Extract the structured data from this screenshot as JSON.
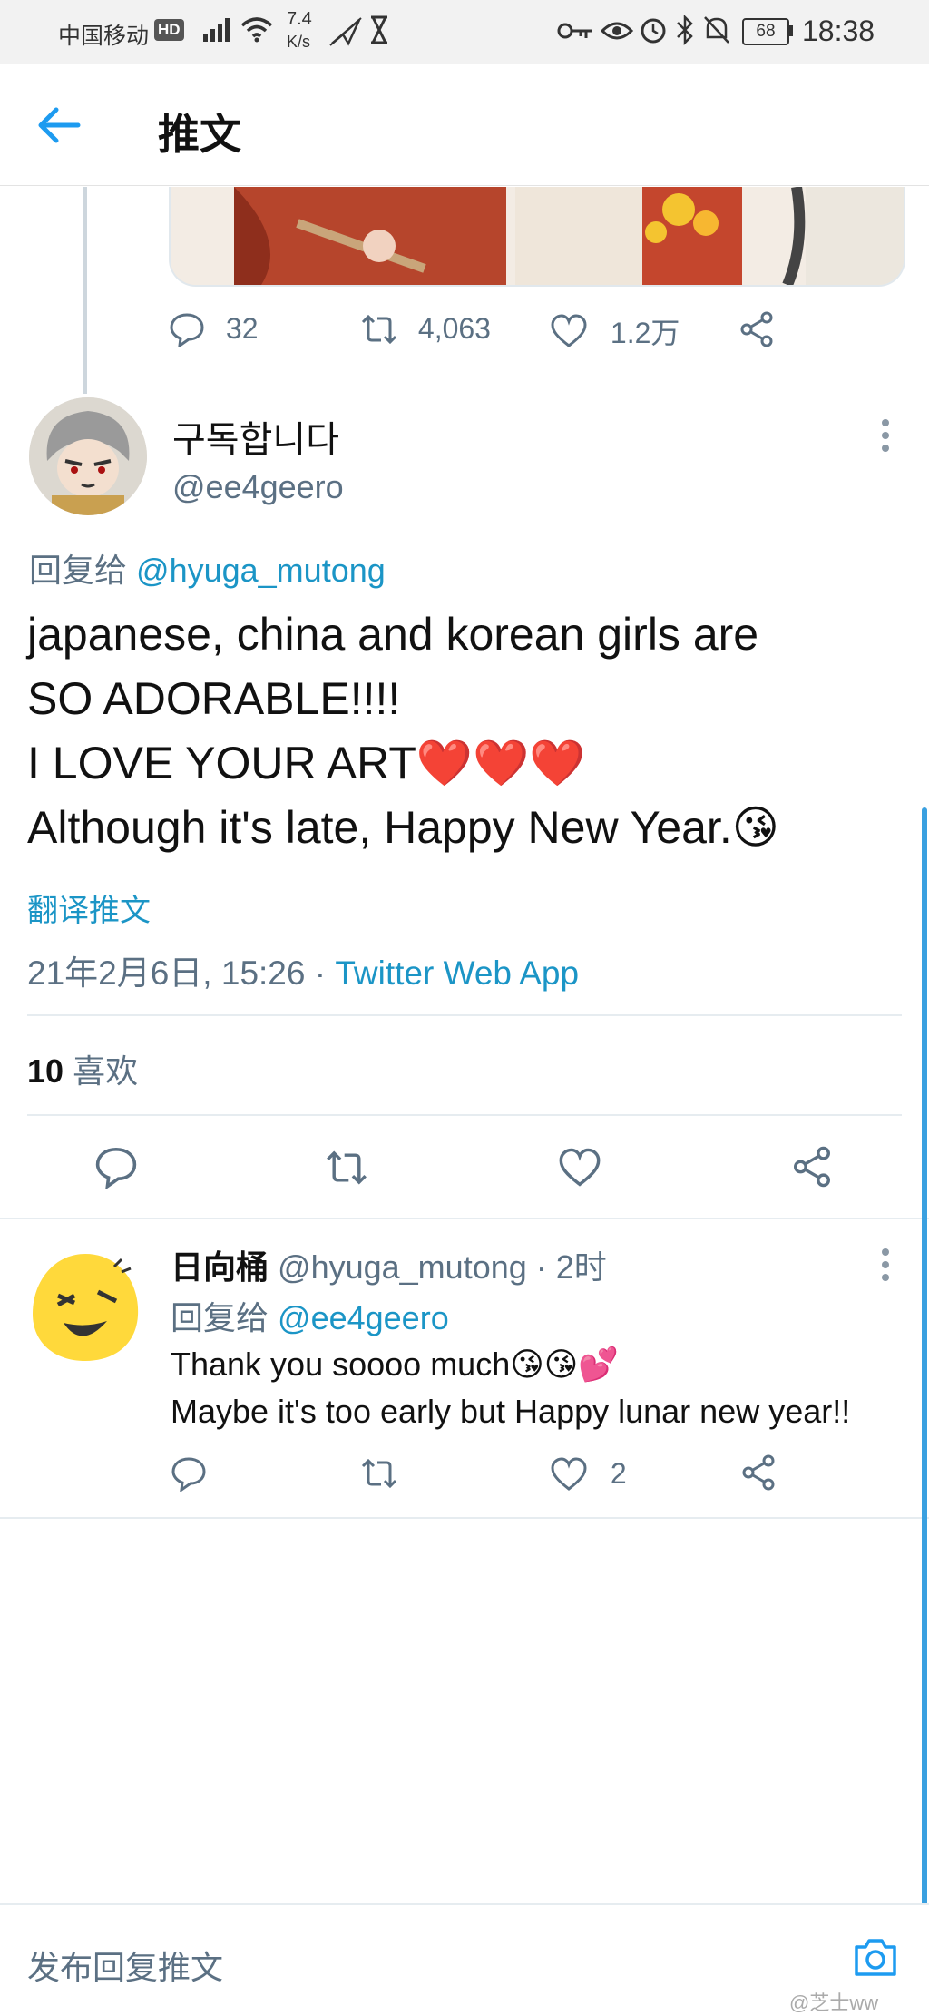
{
  "status_bar": {
    "carrier": "中国移动",
    "hd": "HD",
    "speed_value": "7.4",
    "speed_unit": "K/s",
    "battery": "68",
    "time": "18:38"
  },
  "header": {
    "title": "推文"
  },
  "prev_tweet": {
    "replies": "32",
    "retweets": "4,063",
    "likes": "1.2万"
  },
  "tweet": {
    "display_name": "구독합니다",
    "handle": "@ee4geero",
    "reply_prefix": "回复给",
    "reply_to": "@hyuga_mutong",
    "lines": [
      "japanese, china and korean girls are",
      "SO ADORABLE!!!!",
      "I LOVE YOUR ART❤️❤️❤️",
      "Although it's late, Happy New Year.😘"
    ],
    "translate": "翻译推文",
    "date": "21年2月6日, 15:26",
    "separator": " · ",
    "source": "Twitter Web App",
    "likes_count": "10",
    "likes_label": "喜欢"
  },
  "reply": {
    "display_name": "日向桶",
    "handle": "@hyuga_mutong",
    "time": "· 2时",
    "reply_prefix": "回复给",
    "reply_to": "@ee4geero",
    "line1": "Thank you soooo much😘😘💕",
    "line2": "Maybe it's too early but Happy lunar new year!!",
    "likes": "2"
  },
  "composer": {
    "placeholder": "发布回复推文"
  },
  "watermark": "@芝士ww"
}
